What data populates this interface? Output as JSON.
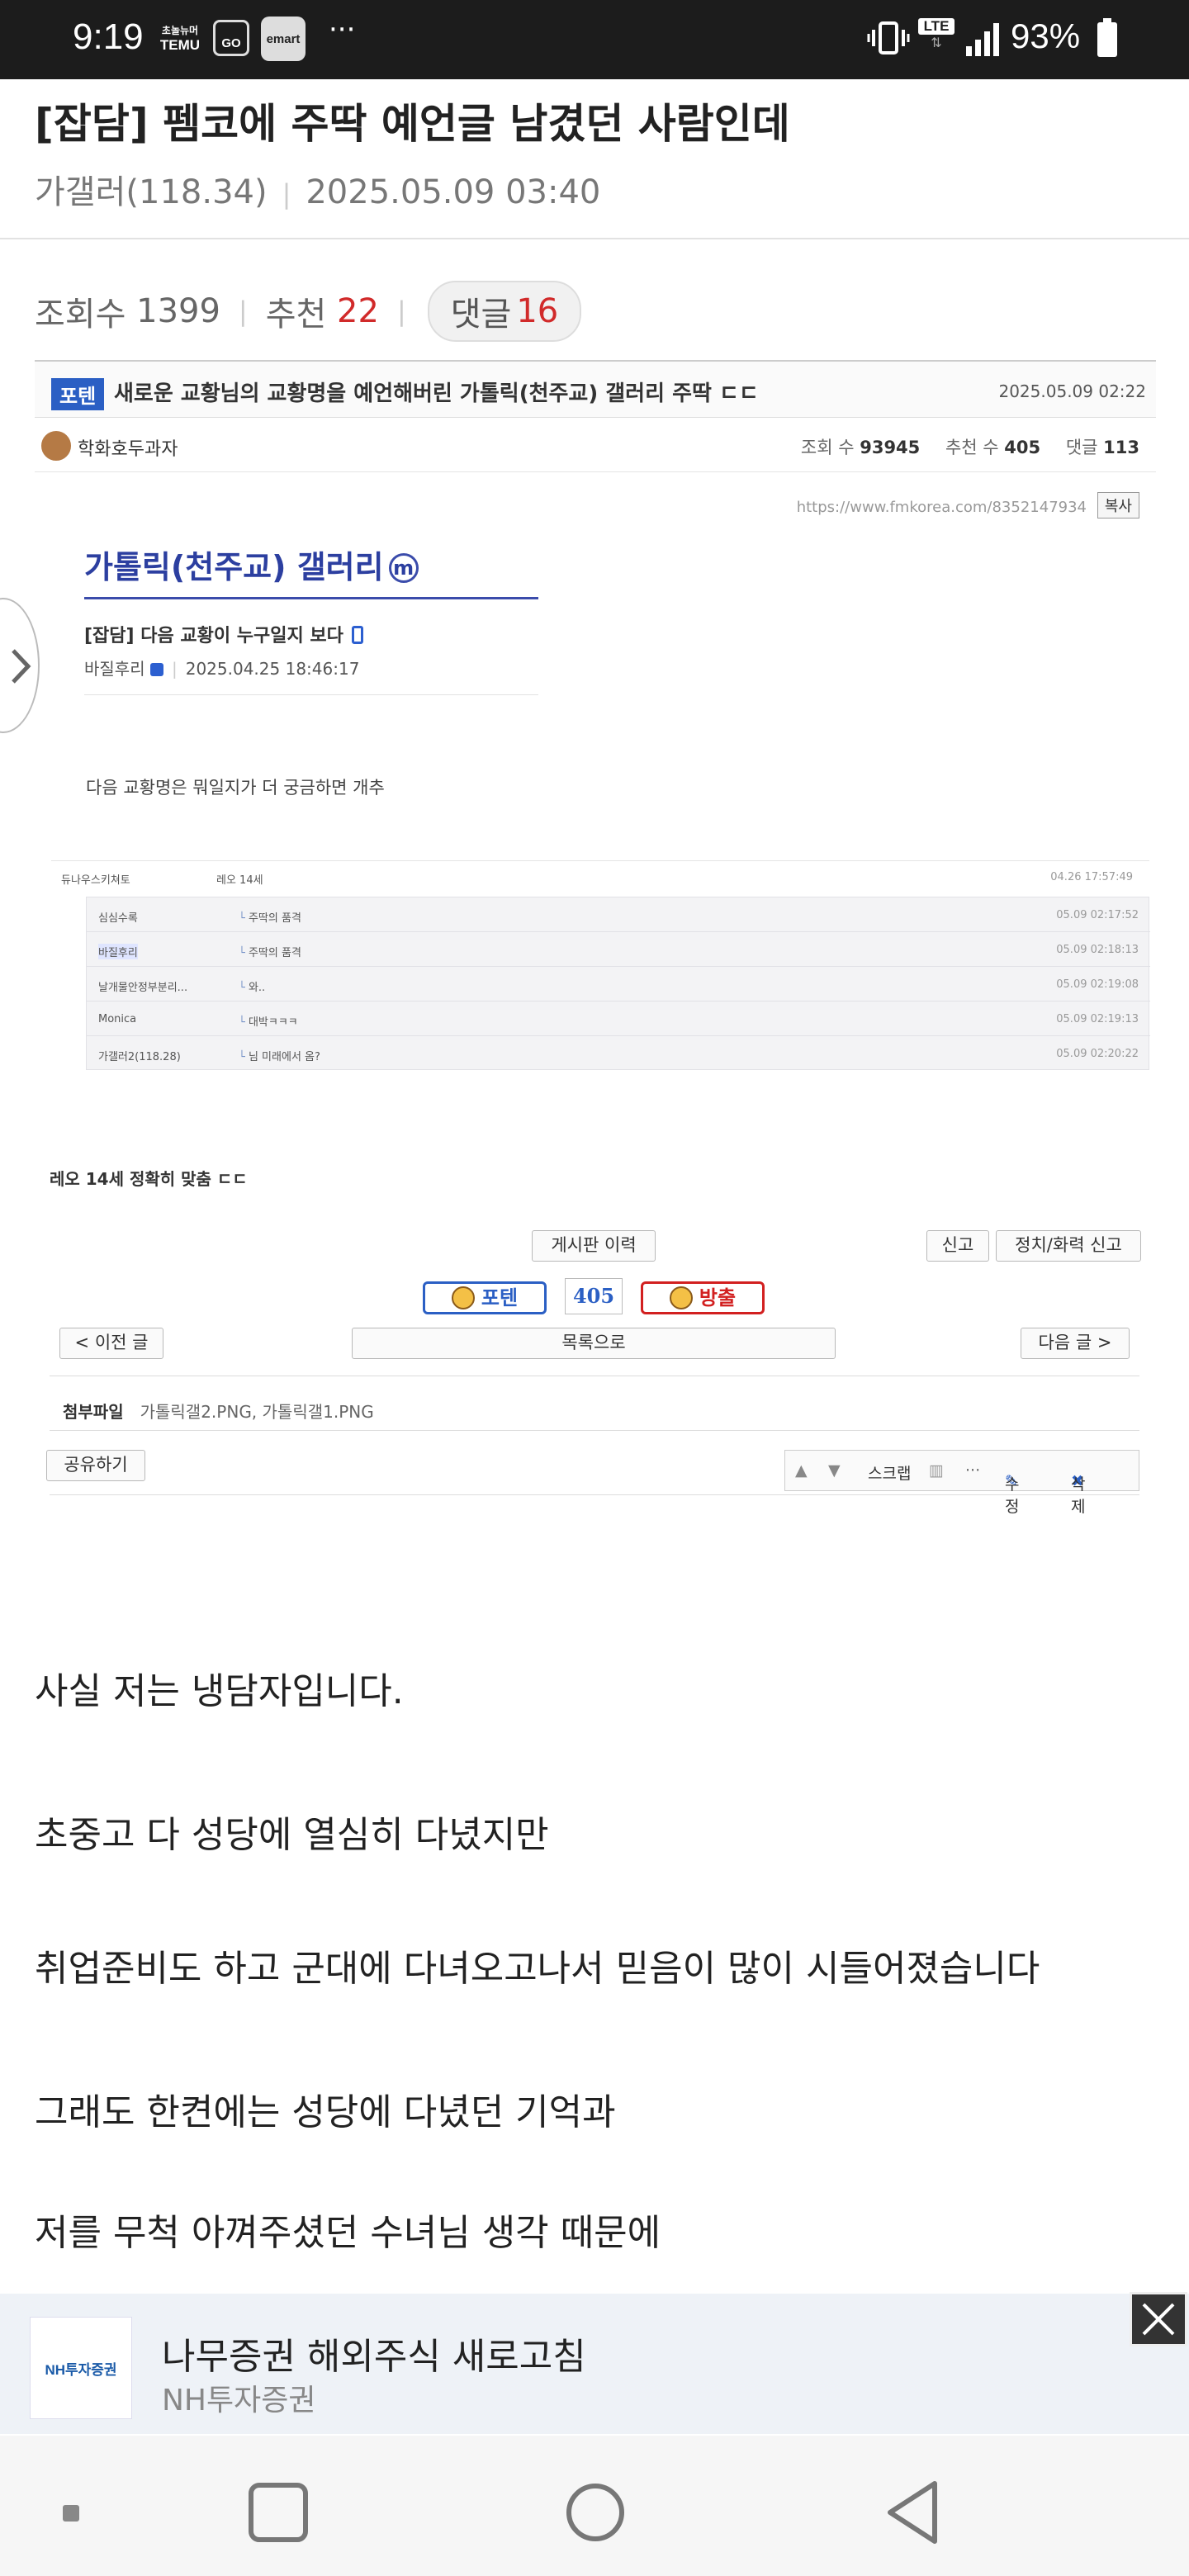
{
  "status_bar": {
    "time": "9:19",
    "temu_line1": "초놀뉴머",
    "temu_line2": "TEMU",
    "go_label": "GO",
    "emart_label": "emart",
    "more": "···",
    "lte": "LTE",
    "battery": "93%"
  },
  "post": {
    "title": "[잡담] 펨코에 주딱 예언글 남겼던 사람인데",
    "author": "가갤러(118.34)",
    "date": "2025.05.09 03:40",
    "views_label": "조회수",
    "views": "1399",
    "likes_label": "추천",
    "likes": "22",
    "comments_label": "댓글",
    "comments": "16"
  },
  "embed": {
    "tag": "포텐",
    "title": "새로운 교황님의 교황명을 예언해버린 가톨릭(천주교) 갤러리 주딱 ㄷㄷ",
    "date": "2025.05.09 02:22",
    "author": "학화호두과자",
    "stats_views_label": "조회 수",
    "stats_views": "93945",
    "stats_likes_label": "추천 수",
    "stats_likes": "405",
    "stats_comments_label": "댓글",
    "stats_comments": "113",
    "url": "https://www.fmkorea.com/8352147934",
    "copy_label": "복사",
    "dc_gallery": "가톨릭(천주교) 갤러리",
    "dc_gallery_badge": "m",
    "dc_post_title": "[잡담] 다음 교황이 누구일지 보다",
    "dc_post_author": "바질후리",
    "dc_post_date": "2025.04.25 18:46:17",
    "dc_body": "다음 교황명은 뭐일지가 더 궁금하면 개추",
    "comment_head": {
      "nick": "듀나우스키쳐토",
      "text": "레오 14세",
      "date": "04.26 17:57:49"
    },
    "replies": [
      {
        "nick": "심심수록",
        "text": "주딱의 품격",
        "date": "05.09 02:17:52"
      },
      {
        "nick": "바질후리",
        "text": "주딱의 품격",
        "date": "05.09 02:18:13"
      },
      {
        "nick": "날개물안정부분리...",
        "text": "와..",
        "date": "05.09 02:19:08"
      },
      {
        "nick": "Monica",
        "text": "대박ㅋㅋㅋ",
        "date": "05.09 02:19:13"
      },
      {
        "nick": "가갤러2(118.28)",
        "text": "님 미래에서 옴?",
        "date": "05.09 02:20:22"
      }
    ],
    "conclusion": "레오 14세 정확히 맞춤 ㄷㄷ",
    "board_history": "게시판 이력",
    "report": "신고",
    "political_report": "정치/화력 신고",
    "vote_up": "포텐",
    "vote_count": "405",
    "vote_down": "방출",
    "prev": "< 이전 글",
    "list": "목록으로",
    "next": "다음 글 >",
    "attach_label": "첨부파일",
    "attach_files": "가톨릭갤2.PNG,  가톨릭갤1.PNG",
    "share": "공유하기",
    "scrap": "스크랩",
    "more": "···",
    "edit": "수정",
    "delete": "삭제"
  },
  "body_lines": [
    "사실 저는 냉담자입니다.",
    "초중고 다 성당에 열심히 다녔지만",
    "취업준비도 하고 군대에 다녀오고나서 믿음이 많이 시들어졌습니다",
    "그래도 한켠에는 성당에 다녔던 기억과",
    "저를 무척 아껴주셨던 수녀님 생각 때문에"
  ],
  "ad": {
    "logo_text": "NH투자증권",
    "title": "나무증권 해외주식 새로고침",
    "subtitle": "NH투자증권"
  }
}
